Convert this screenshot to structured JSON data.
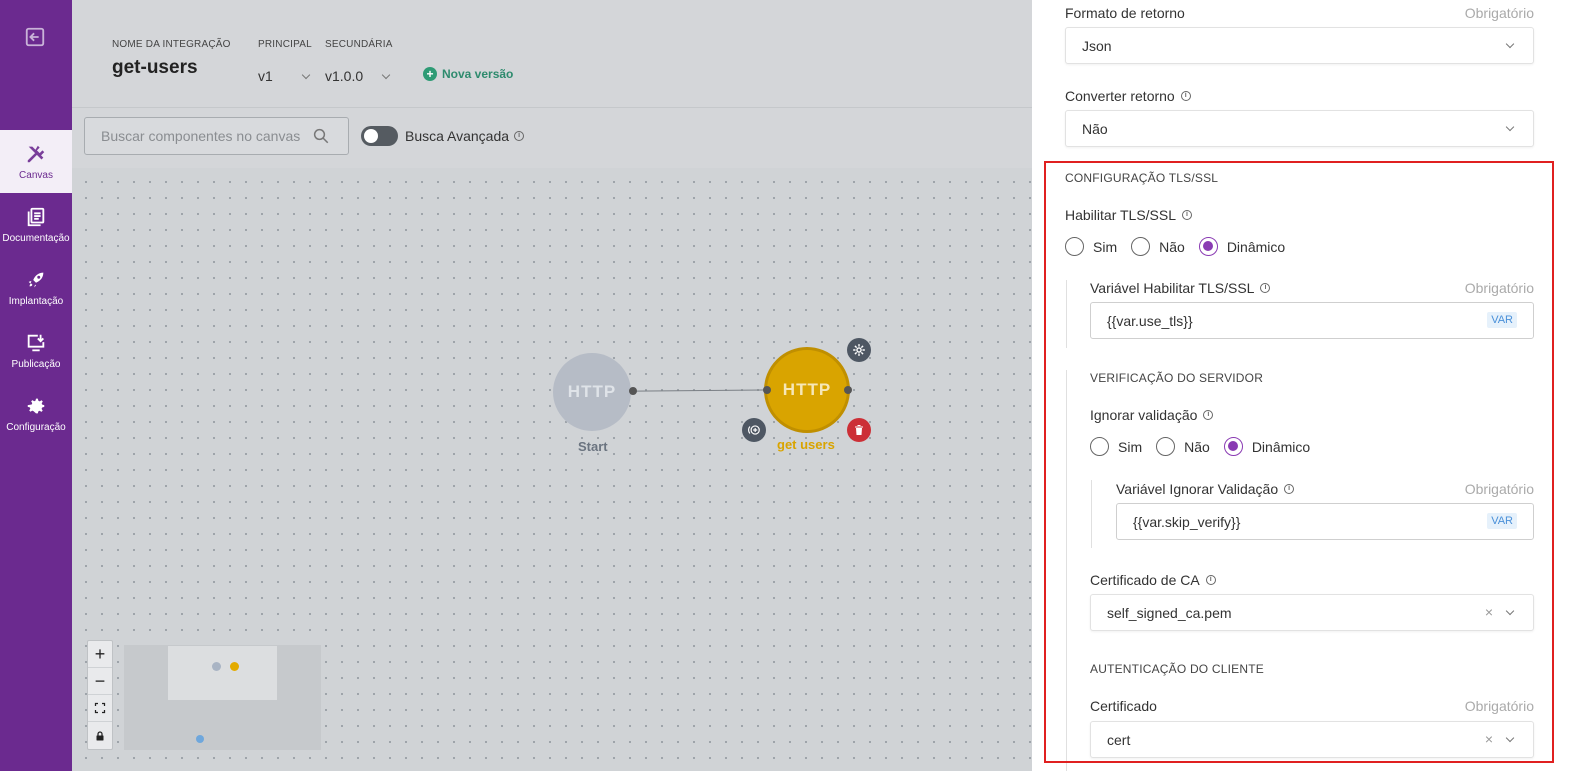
{
  "sidebar": {
    "exit_icon": "exit-icon",
    "items": [
      {
        "label": "Canvas",
        "icon": "tools-icon",
        "active": true
      },
      {
        "label": "Documentação",
        "icon": "book-icon",
        "active": false
      },
      {
        "label": "Implantação",
        "icon": "rocket-icon",
        "active": false
      },
      {
        "label": "Publicação",
        "icon": "publish-icon",
        "active": false
      },
      {
        "label": "Configuração",
        "icon": "gear-icon",
        "active": false
      }
    ]
  },
  "header": {
    "name_label": "NOME DA INTEGRAÇÃO",
    "name": "get-users",
    "principal_label": "PRINCIPAL",
    "principal": "v1",
    "secundaria_label": "SECUNDÁRIA",
    "secundaria": "v1.0.0",
    "nova_versao": "Nova versão"
  },
  "toolbar": {
    "search_placeholder": "Buscar componentes no canvas",
    "advanced_search": "Busca Avançada",
    "advanced_enabled": false
  },
  "canvas": {
    "nodes": [
      {
        "text": "HTTP",
        "label": "Start"
      },
      {
        "text": "HTTP",
        "label": "get users"
      }
    ],
    "zoom_controls": [
      "+",
      "−"
    ]
  },
  "panel": {
    "formato_label": "Formato de retorno",
    "formato_value": "Json",
    "obrigatorio": "Obrigatório",
    "converter_label": "Converter retorno",
    "converter_value": "Não",
    "tls_section": "CONFIGURAÇÃO TLS/SSL",
    "habilitar_label": "Habilitar TLS/SSL",
    "habilitar_options": [
      "Sim",
      "Não",
      "Dinâmico"
    ],
    "habilitar_selected": "Dinâmico",
    "var_habilitar_label": "Variável Habilitar TLS/SSL",
    "var_habilitar_value": "{{var.use_tls}}",
    "var_tag": "VAR",
    "verif_section": "VERIFICAÇÃO DO SERVIDOR",
    "ignorar_label": "Ignorar validação",
    "ignorar_options": [
      "Sim",
      "Não",
      "Dinâmico"
    ],
    "ignorar_selected": "Dinâmico",
    "var_ignorar_label": "Variável Ignorar Validação",
    "var_ignorar_value": "{{var.skip_verify}}",
    "ca_label": "Certificado de CA",
    "ca_value": "self_signed_ca.pem",
    "auth_section": "AUTENTICAÇÃO DO CLIENTE",
    "cert_label": "Certificado",
    "cert_value": "cert",
    "clear_glyph": "×"
  },
  "colors": {
    "sidebar": "#6b2a8f",
    "accent_radio": "#8a3bb3",
    "node_active": "#d9a400",
    "highlight_box": "#e02020"
  }
}
